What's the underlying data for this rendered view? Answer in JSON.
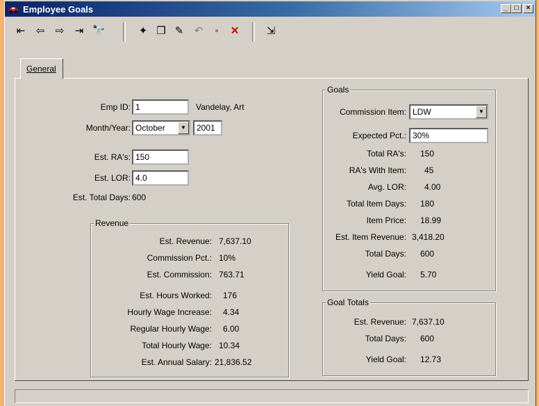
{
  "window": {
    "title": "Employee Goals"
  },
  "toolbar": {
    "nav": [
      {
        "name": "first-record-icon",
        "glyph": "⇤"
      },
      {
        "name": "previous-record-icon",
        "glyph": "⇦"
      },
      {
        "name": "next-record-icon",
        "glyph": "⇨"
      },
      {
        "name": "last-record-icon",
        "glyph": "⇥"
      },
      {
        "name": "find-icon",
        "glyph": "🔭"
      }
    ],
    "edit": [
      {
        "name": "new-record-icon",
        "glyph": "✦"
      },
      {
        "name": "copy-record-icon",
        "glyph": "❐"
      },
      {
        "name": "edit-record-icon",
        "glyph": "✎"
      },
      {
        "name": "undo-icon",
        "glyph": "↶"
      },
      {
        "name": "save-icon",
        "glyph": "▪"
      },
      {
        "name": "delete-icon",
        "glyph": "✕"
      }
    ],
    "exit": {
      "name": "exit-icon",
      "glyph": "⇲"
    }
  },
  "tabs": {
    "general": "General"
  },
  "employee": {
    "emp_id_label": "Emp ID:",
    "emp_id": "1",
    "emp_name": "Vandelay, Art",
    "month_year_label": "Month/Year:",
    "month": "October",
    "year": "2001",
    "est_ras_label": "Est. RA's:",
    "est_ras": "150",
    "est_lor_label": "Est. LOR:",
    "est_lor": "4.0",
    "est_total_days_label": "Est. Total Days:",
    "est_total_days": "600"
  },
  "revenue": {
    "title": "Revenue",
    "rows": [
      {
        "label": "Est. Revenue:",
        "value": "7,637.10"
      },
      {
        "label": "Commission Pct.:",
        "value": "10%"
      },
      {
        "label": "Est. Commission:",
        "value": "763.71"
      },
      {
        "label": "Est. Hours Worked:",
        "value": "176"
      },
      {
        "label": "Hourly Wage Increase:",
        "value": "4.34"
      },
      {
        "label": "Regular Hourly Wage:",
        "value": "6.00"
      },
      {
        "label": "Total Hourly Wage:",
        "value": "10.34"
      },
      {
        "label": "Est. Annual Salary:",
        "value": "21,836.52"
      }
    ]
  },
  "goals": {
    "title": "Goals",
    "commission_item_label": "Commission Item:",
    "commission_item": "LDW",
    "expected_pct_label": "Expected Pct.:",
    "expected_pct": "30%",
    "rows": [
      {
        "label": "Total RA's:",
        "value": "150"
      },
      {
        "label": "RA's With Item:",
        "value": "45"
      },
      {
        "label": "Avg. LOR:",
        "value": "4.00"
      },
      {
        "label": "Total Item Days:",
        "value": "180"
      },
      {
        "label": "Item Price:",
        "value": "18.99"
      },
      {
        "label": "Est. Item Revenue:",
        "value": "3,418.20"
      },
      {
        "label": "Total Days:",
        "value": "600"
      },
      {
        "label": "Yield Goal:",
        "value": "5.70"
      }
    ]
  },
  "goal_totals": {
    "title": "Goal Totals",
    "rows": [
      {
        "label": "Est. Revenue:",
        "value": "7,637.10"
      },
      {
        "label": "Total Days:",
        "value": "600"
      },
      {
        "label": "Yield Goal:",
        "value": "12.73"
      }
    ]
  },
  "colors": {
    "titlebar_start": "#0a246a",
    "face": "#d4d0c8",
    "delete_red": "#cc0000"
  }
}
